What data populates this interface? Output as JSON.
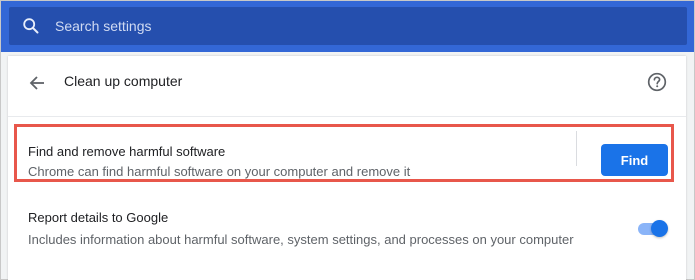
{
  "search": {
    "placeholder": "Search settings",
    "icon": "search-icon"
  },
  "header": {
    "title": "Clean up computer",
    "back_icon": "arrow-back-icon",
    "help_icon": "help-icon"
  },
  "find_row": {
    "title": "Find and remove harmful software",
    "subtitle": "Chrome can find harmful software on your computer and remove it",
    "button_label": "Find"
  },
  "report_row": {
    "title": "Report details to Google",
    "subtitle": "Includes information about harmful software, system settings, and processes on your computer",
    "toggle_on": true
  },
  "colors": {
    "topbar": "#3367d6",
    "search_box": "#254fae",
    "accent": "#1a73e8",
    "highlight_border": "#e8574b",
    "toggle_track": "#8ab4f8"
  }
}
